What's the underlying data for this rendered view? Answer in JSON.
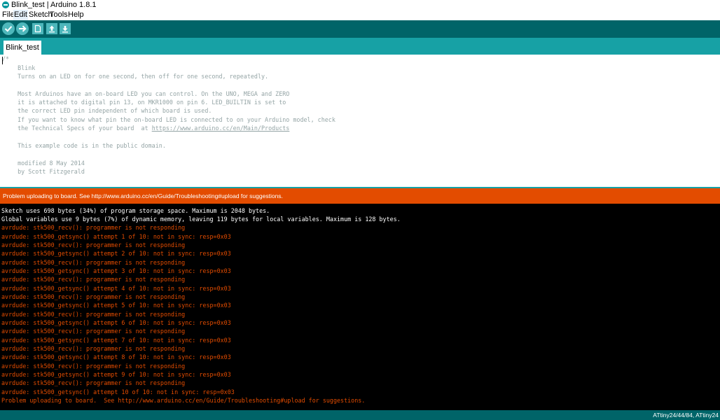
{
  "window": {
    "title": "Blink_test | Arduino 1.8.1"
  },
  "menu": [
    {
      "label": "File"
    },
    {
      "label": "Edit"
    },
    {
      "label": "Sketch"
    },
    {
      "label": "Tools"
    },
    {
      "label": "Help"
    }
  ],
  "toolbar": {
    "buttons": [
      {
        "icon": "verify-icon"
      },
      {
        "icon": "upload-icon"
      },
      {
        "icon": "new-icon"
      },
      {
        "icon": "open-icon"
      },
      {
        "icon": "save-icon"
      }
    ]
  },
  "tab": {
    "label": "Blink_test"
  },
  "editor": {
    "lines": [
      "/*",
      "  Blink",
      "  Turns on an LED on for one second, then off for one second, repeatedly.",
      "",
      "  Most Arduinos have an on-board LED you can control. On the UNO, MEGA and ZERO",
      "  it is attached to digital pin 13, on MKR1000 on pin 6. LED_BUILTIN is set to",
      "  the correct LED pin independent of which board is used.",
      "  If you want to know what pin the on-board LED is connected to on your Arduino model, check",
      "  the Technical Specs of your board  at ",
      "",
      "  This example code is in the public domain.",
      "",
      "  modified 8 May 2014",
      "  by Scott Fitzgerald"
    ],
    "link": "https://www.arduino.cc/en/Main/Products"
  },
  "status": {
    "message": "Problem uploading to board.  See http://www.arduino.cc/en/Guide/Troubleshooting#upload for suggestions."
  },
  "console": {
    "info_lines": [
      "Sketch uses 698 bytes (34%) of program storage space. Maximum is 2048 bytes.",
      "Global variables use 9 bytes (7%) of dynamic memory, leaving 119 bytes for local variables. Maximum is 128 bytes."
    ],
    "error_lines": [
      "avrdude: stk500_recv(): programmer is not responding",
      "avrdude: stk500_getsync() attempt 1 of 10: not in sync: resp=0x03",
      "avrdude: stk500_recv(): programmer is not responding",
      "avrdude: stk500_getsync() attempt 2 of 10: not in sync: resp=0x03",
      "avrdude: stk500_recv(): programmer is not responding",
      "avrdude: stk500_getsync() attempt 3 of 10: not in sync: resp=0x03",
      "avrdude: stk500_recv(): programmer is not responding",
      "avrdude: stk500_getsync() attempt 4 of 10: not in sync: resp=0x03",
      "avrdude: stk500_recv(): programmer is not responding",
      "avrdude: stk500_getsync() attempt 5 of 10: not in sync: resp=0x03",
      "avrdude: stk500_recv(): programmer is not responding",
      "avrdude: stk500_getsync() attempt 6 of 10: not in sync: resp=0x03",
      "avrdude: stk500_recv(): programmer is not responding",
      "avrdude: stk500_getsync() attempt 7 of 10: not in sync: resp=0x03",
      "avrdude: stk500_recv(): programmer is not responding",
      "avrdude: stk500_getsync() attempt 8 of 10: not in sync: resp=0x03",
      "avrdude: stk500_recv(): programmer is not responding",
      "avrdude: stk500_getsync() attempt 9 of 10: not in sync: resp=0x03",
      "avrdude: stk500_recv(): programmer is not responding",
      "avrdude: stk500_getsync() attempt 10 of 10: not in sync: resp=0x03",
      "Problem uploading to board.  See http://www.arduino.cc/en/Guide/Troubleshooting#upload for suggestions."
    ]
  },
  "footer": {
    "board": "ATtiny24/44/84, ATtiny24"
  },
  "colors": {
    "toolbar": "#006468",
    "tabstrip": "#17a1a5",
    "error_bar": "#e34c00",
    "console_bg": "#000000",
    "comment_text": "#95a5a6"
  }
}
